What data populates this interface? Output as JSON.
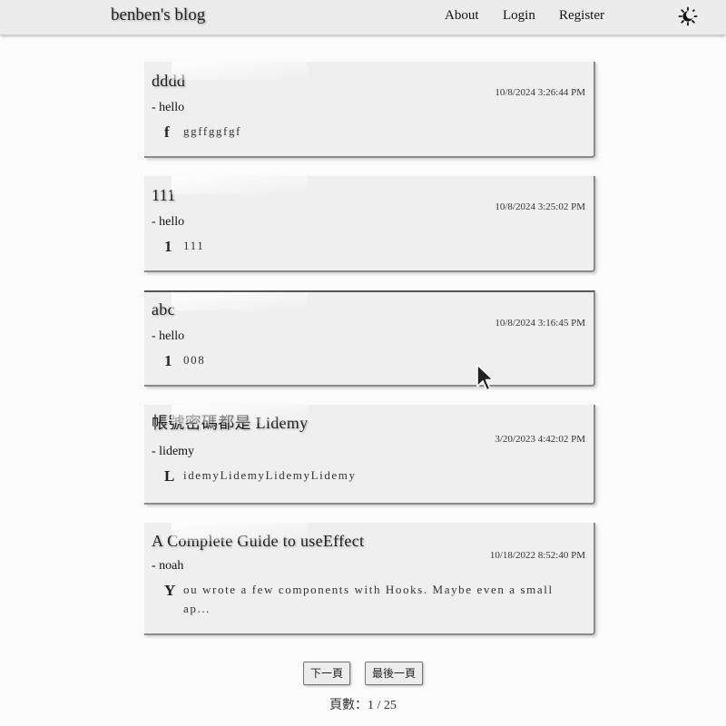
{
  "navbar": {
    "brand": "benben's blog",
    "links": {
      "about": "About",
      "login": "Login",
      "register": "Register"
    },
    "theme_icon": "moon-sun-icon"
  },
  "posts": [
    {
      "title": "dddd",
      "date": "10/8/2024 3:26:44 PM",
      "author": "- hello",
      "dropcap": "f",
      "excerpt": "ggffggfgf"
    },
    {
      "title": "111",
      "date": "10/8/2024 3:25:02 PM",
      "author": "- hello",
      "dropcap": "1",
      "excerpt": "111"
    },
    {
      "title": "abc",
      "date": "10/8/2024 3:16:45 PM",
      "author": "- hello",
      "dropcap": "1",
      "excerpt": "008"
    },
    {
      "title": "帳號密碼都是 Lidemy",
      "date": "3/20/2023 4:42:02 PM",
      "author": "- lidemy",
      "dropcap": "L",
      "excerpt": "idemyLidemyLidemyLidemy"
    },
    {
      "title": "A Complete Guide to useEffect",
      "date": "10/18/2022 8:52:40 PM",
      "author": "- noah",
      "dropcap": "Y",
      "excerpt": "ou wrote a few components with Hooks. Maybe even a small ap..."
    }
  ],
  "pagination": {
    "next_label": "下一頁",
    "last_label": "最後一頁",
    "page_info": "頁數：1 / 25"
  },
  "colors": {
    "background": "#fbfbfb",
    "navbar": "#ececec",
    "card": "#efefef",
    "card_border": "#8a8a8a"
  }
}
